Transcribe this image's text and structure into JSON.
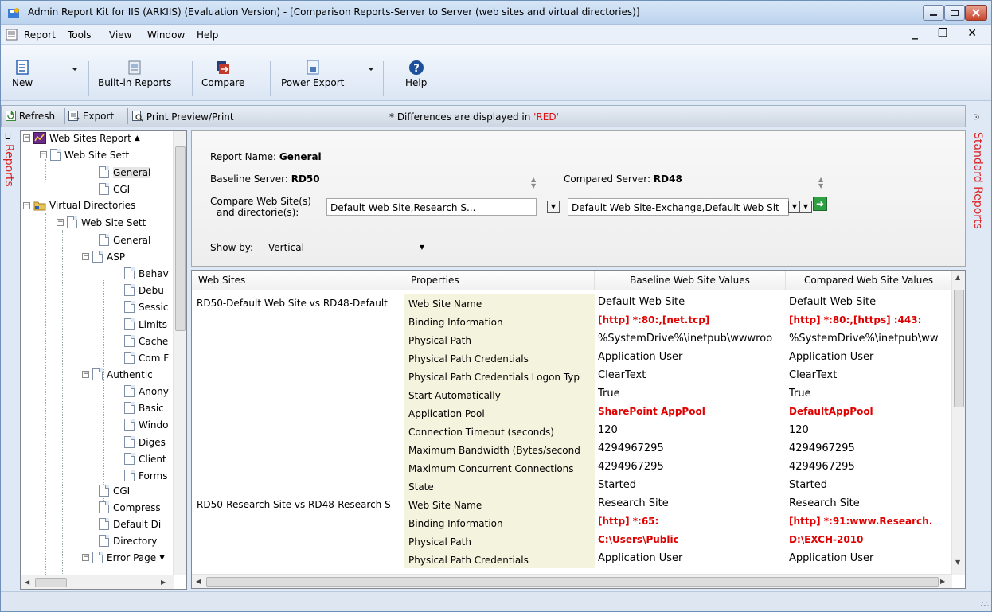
{
  "window": {
    "title": "Admin Report Kit for IIS (ARKIIS) (Evaluation Version) - [Comparison Reports-Server to Server (web sites and virtual directories)]",
    "controls": [
      "minimize-icon",
      "maximize-icon",
      "close-icon"
    ]
  },
  "menu": {
    "items": [
      "Report",
      "Tools",
      "View",
      "Window",
      "Help"
    ],
    "mdi_controls": "_ ❒ ✕"
  },
  "toolbar": {
    "new": "New",
    "builtin": "Built-in Reports",
    "compare": "Compare",
    "power_export": "Power Export",
    "help": "Help"
  },
  "actions": {
    "refresh": "Refresh",
    "export": "Export",
    "print": "Print Preview/Print",
    "diff_note": "* Differences are displayed in ",
    "diff_red": "'RED'"
  },
  "side_panels": {
    "left": "Reports",
    "right": "Standard Reports"
  },
  "tree": {
    "nodes": [
      "Web Sites Report",
      "Web Site Sett",
      "General",
      "CGI",
      "Virtual Directories",
      "Web Site Sett",
      "General",
      "ASP",
      "Behav",
      "Debu",
      "Sessic",
      "Limits",
      "Cache",
      "Com F",
      "Authentic",
      "Anony",
      "Basic",
      "Windo",
      "Diges",
      "Client",
      "Forms",
      "CGI",
      "Compress",
      "Default Di",
      "Directory",
      "Error Page"
    ],
    "selected": "General"
  },
  "params": {
    "report_name_label": "Report Name:",
    "report_name": "General",
    "baseline_label": "Baseline Server:",
    "baseline": "RD50",
    "compared_label": "Compared Server:",
    "compared": "RD48",
    "compare_label_1": "Compare Web Site(s)",
    "compare_label_2": "and directorie(s):",
    "baseline_sites": "Default Web Site,Research S...",
    "compared_sites": "Default Web Site-Exchange,Default Web Sit",
    "showby_label": "Show by:",
    "showby": "Vertical"
  },
  "grid": {
    "headers": [
      "Web Sites",
      "Properties",
      "Baseline Web Site Values",
      "Compared Web Site Values"
    ],
    "rows": [
      {
        "site": "RD50-Default Web Site vs RD48-Default",
        "prop": "Web Site Name",
        "base": "Default Web Site",
        "comp": "Default Web Site",
        "diff": false
      },
      {
        "site": "",
        "prop": "Binding Information",
        "base": "[http] *:80:,[net.tcp]",
        "comp": "[http] *:80:,[https] :443:",
        "diff": true
      },
      {
        "site": "",
        "prop": "Physical Path",
        "base": "%SystemDrive%\\inetpub\\wwwroo",
        "comp": "%SystemDrive%\\inetpub\\ww",
        "diff": false
      },
      {
        "site": "",
        "prop": "Physical Path Credentials",
        "base": "Application User",
        "comp": "Application User",
        "diff": false
      },
      {
        "site": "",
        "prop": "Physical Path Credentials Logon Typ",
        "base": "ClearText",
        "comp": "ClearText",
        "diff": false
      },
      {
        "site": "",
        "prop": "Start Automatically",
        "base": "True",
        "comp": "True",
        "diff": false
      },
      {
        "site": "",
        "prop": "Application Pool",
        "base": "SharePoint AppPool",
        "comp": "DefaultAppPool",
        "diff": true
      },
      {
        "site": "",
        "prop": "Connection Timeout (seconds)",
        "base": "120",
        "comp": "120",
        "diff": false
      },
      {
        "site": "",
        "prop": "Maximum Bandwidth (Bytes/second",
        "base": "4294967295",
        "comp": "4294967295",
        "diff": false
      },
      {
        "site": "",
        "prop": "Maximum Concurrent Connections",
        "base": "4294967295",
        "comp": "4294967295",
        "diff": false
      },
      {
        "site": "",
        "prop": "State",
        "base": "Started",
        "comp": "Started",
        "diff": false
      },
      {
        "site": "RD50-Research Site vs RD48-Research S",
        "prop": "Web Site Name",
        "base": "Research Site",
        "comp": "Research Site",
        "diff": false
      },
      {
        "site": "",
        "prop": "Binding Information",
        "base": "[http] *:65:",
        "comp": "[http] *:91:www.Research.",
        "diff": true
      },
      {
        "site": "",
        "prop": "Physical Path",
        "base": "C:\\Users\\Public",
        "comp": "D:\\EXCH-2010",
        "diff": true
      },
      {
        "site": "",
        "prop": "Physical Path Credentials",
        "base": "Application User",
        "comp": "Application User",
        "diff": false
      }
    ]
  },
  "colors": {
    "diff": "#e00000",
    "property_bg": "#f4f3de",
    "panel_label": "#dd2222"
  }
}
